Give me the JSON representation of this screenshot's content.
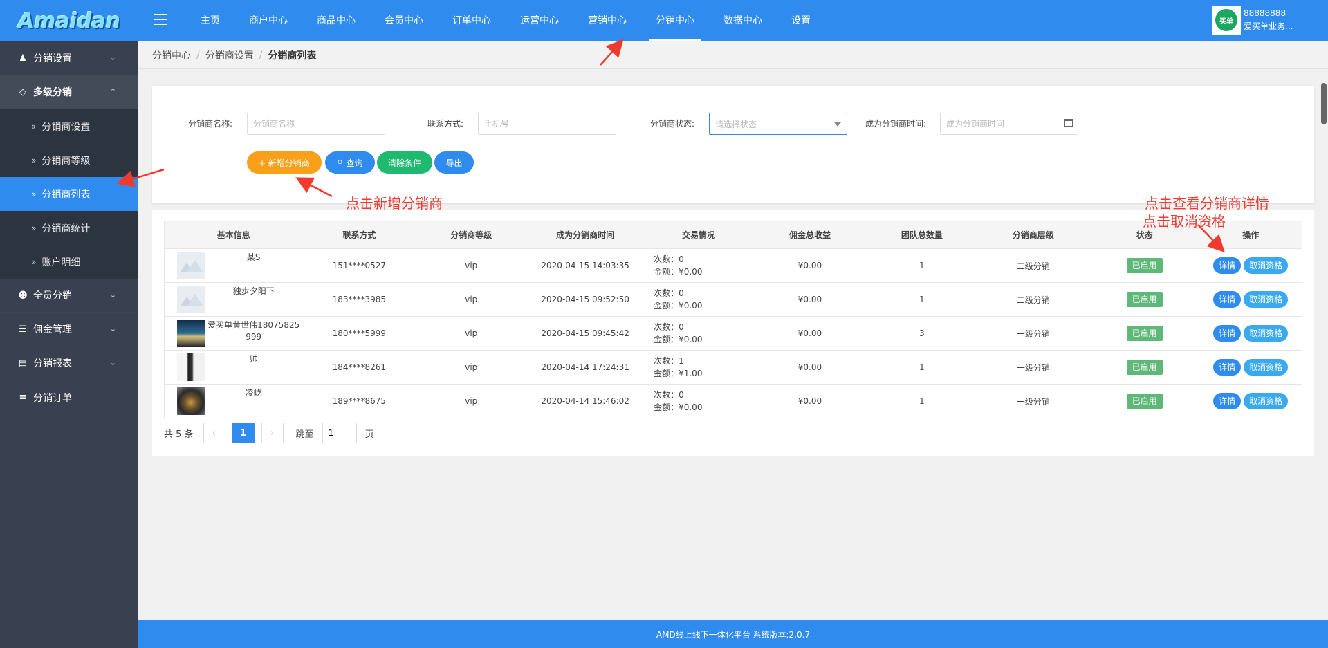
{
  "header": {
    "logo": "Amaidan",
    "nav": [
      "主页",
      "商户中心",
      "商品中心",
      "会员中心",
      "订单中心",
      "运营中心",
      "营销中心",
      "分销中心",
      "数据中心",
      "设置"
    ],
    "active_nav": "分销中心",
    "user_id": "88888888",
    "user_name": "爱买单业务...",
    "avatar_text": "买单"
  },
  "sidebar": {
    "groups": [
      {
        "label": "分销设置",
        "icon": "users-icon"
      },
      {
        "label": "多级分销",
        "icon": "link-icon",
        "open": true
      },
      {
        "label": "全员分销",
        "icon": "user-icon"
      },
      {
        "label": "佣金管理",
        "icon": "database-icon"
      },
      {
        "label": "分销报表",
        "icon": "report-icon"
      },
      {
        "label": "分销订单",
        "icon": "list-icon"
      }
    ],
    "sub_items": [
      "分销商设置",
      "分销商等级",
      "分销商列表",
      "分销商统计",
      "账户明细"
    ],
    "active_sub": "分销商列表"
  },
  "breadcrumb": [
    "分销中心",
    "分销商设置",
    "分销商列表"
  ],
  "filter": {
    "name_label": "分销商名称:",
    "name_placeholder": "分销商名称",
    "contact_label": "联系方式:",
    "contact_placeholder": "手机号",
    "status_label": "分销商状态:",
    "status_placeholder": "请选择状态",
    "time_label": "成为分销商时间:",
    "time_placeholder": "成为分销商时间",
    "buttons": {
      "add": "+ 新增分销商",
      "query": "查询",
      "clear": "清除条件",
      "export": "导出"
    }
  },
  "annotations": {
    "add_hint": "点击新增分销商",
    "detail_hint": "点击查看分销商详情",
    "cancel_hint": "点击取消资格"
  },
  "table": {
    "headers": [
      "基本信息",
      "联系方式",
      "分销商等级",
      "成为分销商时间",
      "交易情况",
      "佣金总收益",
      "团队总数量",
      "分销商层级",
      "状态",
      "操作"
    ],
    "rows": [
      {
        "name": "某S",
        "thumb": "placeholder",
        "phone": "151****0527",
        "level": "vip",
        "time": "2020-04-15 14:03:35",
        "count": "次数：0",
        "amount": "金额：¥0.00",
        "commission": "¥0.00",
        "team": "1",
        "tier": "二级分销",
        "status": "已启用"
      },
      {
        "name": "独步夕阳下",
        "thumb": "placeholder",
        "phone": "183****3985",
        "level": "vip",
        "time": "2020-04-15 09:52:50",
        "count": "次数：0",
        "amount": "金额：¥0.00",
        "commission": "¥0.00",
        "team": "1",
        "tier": "二级分销",
        "status": "已启用"
      },
      {
        "name": "爱买单黄世伟18075825999",
        "thumb": "sea",
        "phone": "180****5999",
        "level": "vip",
        "time": "2020-04-15 09:45:42",
        "count": "次数：0",
        "amount": "金额：¥0.00",
        "commission": "¥0.00",
        "team": "3",
        "tier": "一级分销",
        "status": "已启用"
      },
      {
        "name": "帅",
        "thumb": "person",
        "phone": "184****8261",
        "level": "vip",
        "time": "2020-04-14 17:24:31",
        "count": "次数：1",
        "amount": "金额：¥1.00",
        "commission": "¥0.00",
        "team": "1",
        "tier": "一级分销",
        "status": "已启用"
      },
      {
        "name": "凌屹",
        "thumb": "bike",
        "phone": "189****8675",
        "level": "vip",
        "time": "2020-04-14 15:46:02",
        "count": "次数：0",
        "amount": "金额：¥0.00",
        "commission": "¥0.00",
        "team": "1",
        "tier": "一级分销",
        "status": "已启用"
      }
    ],
    "op_detail": "详情",
    "op_cancel": "取消资格"
  },
  "pager": {
    "total": "共 5 条",
    "current": "1",
    "jump_label": "跳至",
    "jump_value": "1",
    "page_unit": "页"
  },
  "footer": "AMD线上线下一体化平台 系统版本:2.0.7",
  "colors": {
    "primary": "#2f8cee",
    "sidebar": "#394150",
    "orange": "#f9a01b",
    "green": "#1fb96f",
    "status": "#5fb878",
    "annotation": "#f03a2e"
  }
}
